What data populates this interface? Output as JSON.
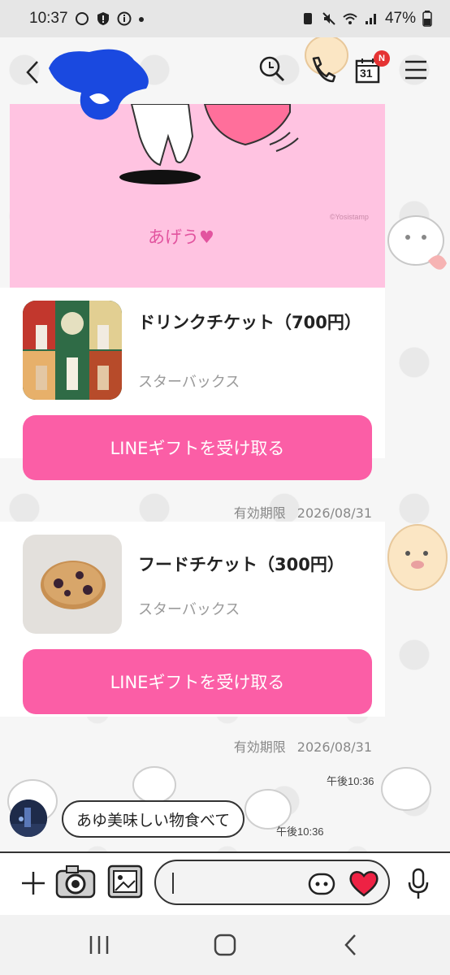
{
  "status_bar": {
    "time": "10:37",
    "battery": "47%"
  },
  "header": {
    "calendar_date": "31",
    "calendar_badge": "N"
  },
  "stamp": {
    "text": "あげう♥",
    "credit": "©Yosistamp"
  },
  "gifts": [
    {
      "title": "ドリンクチケット（700円）",
      "brand": "スターバックス",
      "button": "LINEギフトを受け取る",
      "expiry_label": "有効期限",
      "expiry_date": "2026/08/31"
    },
    {
      "title": "フードチケット（300円）",
      "brand": "スターバックス",
      "button": "LINEギフトを受け取る",
      "expiry_label": "有効期限",
      "expiry_date": "2026/08/31"
    }
  ],
  "times": {
    "sent": "午後10:36",
    "received": "午後10:36"
  },
  "message": {
    "text": "あゆ美味しい物食べて"
  },
  "colors": {
    "accent": "#fb5ea6",
    "stamp_bg": "#ffc3e1",
    "header_scribble": "#1a49e0",
    "heart": "#ee2244"
  },
  "icons": [
    "back-icon",
    "search-icon",
    "phone-icon",
    "calendar-icon",
    "menu-icon",
    "plus-icon",
    "camera-icon",
    "image-icon",
    "emoji-icon",
    "heart-icon",
    "mic-icon",
    "recents-icon",
    "home-icon",
    "nav-back-icon"
  ]
}
